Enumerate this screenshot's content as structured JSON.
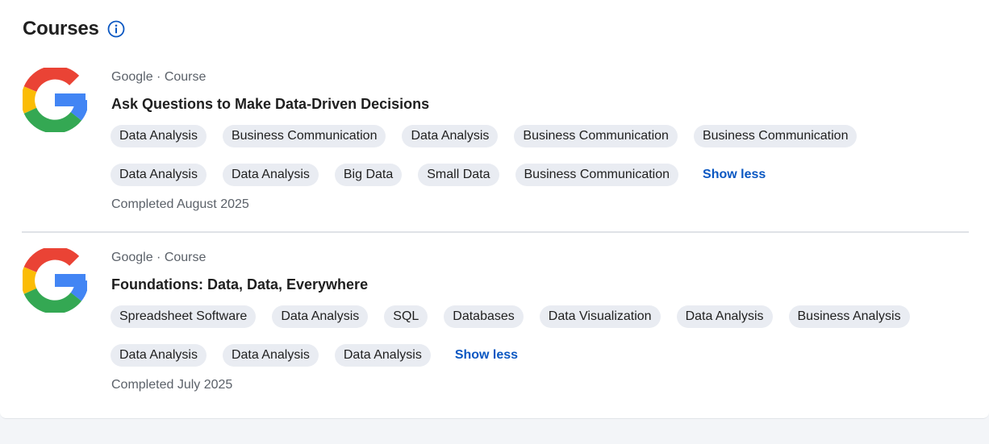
{
  "section": {
    "title": "Courses",
    "info_icon": "info-icon"
  },
  "courses": [
    {
      "logo": "google-logo",
      "meta": "Google · Course",
      "title": "Ask Questions to Make Data-Driven Decisions",
      "tags_row1": [
        "Data Analysis",
        "Business Communication",
        "Data Analysis",
        "Business Communication",
        "Business Communication"
      ],
      "tags_row2": [
        "Data Analysis",
        "Data Analysis",
        "Big Data",
        "Small Data",
        "Business Communication"
      ],
      "toggle_label": "Show less",
      "completed": "Completed August 2025"
    },
    {
      "logo": "google-logo",
      "meta": "Google · Course",
      "title": "Foundations: Data, Data, Everywhere",
      "tags_row1": [
        "Spreadsheet Software",
        "Data Analysis",
        "SQL",
        "Databases",
        "Data Visualization",
        "Data Analysis",
        "Business Analysis"
      ],
      "tags_row2": [
        "Data Analysis",
        "Data Analysis",
        "Data Analysis"
      ],
      "toggle_label": "Show less",
      "completed": "Completed July 2025"
    }
  ],
  "colors": {
    "link": "#0a57c2",
    "tag_bg": "#e9ecf2",
    "google_red": "#EA4335",
    "google_yellow": "#FBBC05",
    "google_green": "#34A853",
    "google_blue": "#4285F4"
  }
}
